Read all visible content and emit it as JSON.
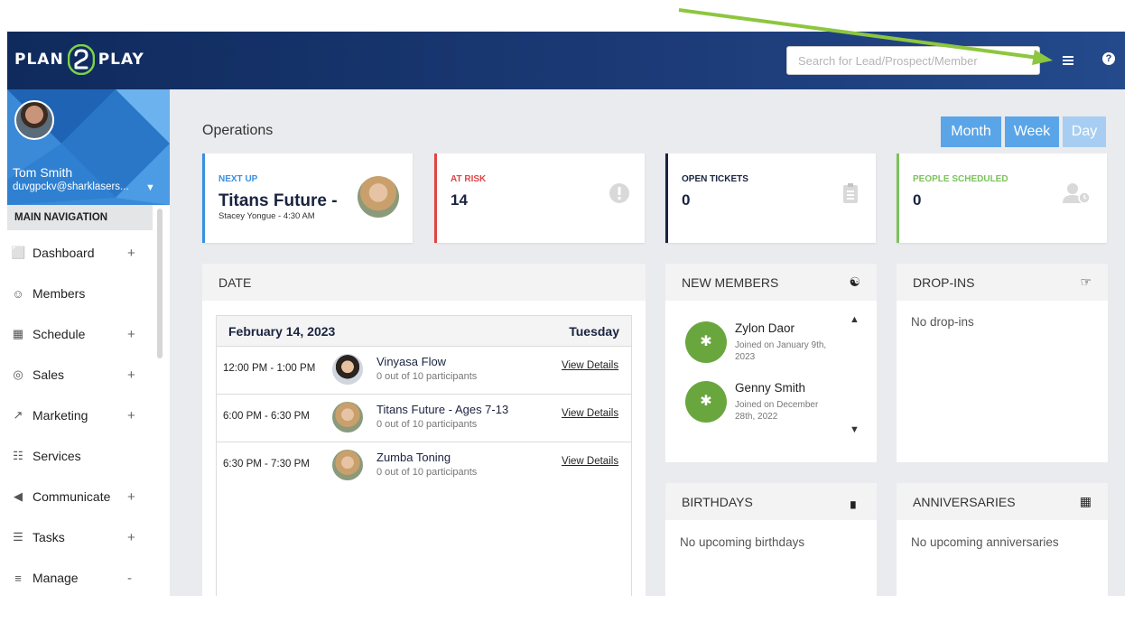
{
  "brand": {
    "left": "PLAN",
    "right": "PLAY"
  },
  "search": {
    "placeholder": "Search for Lead/Prospect/Member"
  },
  "help_glyph": "?",
  "user": {
    "name": "Tom Smith",
    "email": "duvgpckv@sharklasers..."
  },
  "nav": {
    "heading": "MAIN NAVIGATION",
    "items": [
      {
        "label": "Dashboard",
        "icon": "chart-icon",
        "glyph": "⬜",
        "toggle": "+"
      },
      {
        "label": "Members",
        "icon": "users-icon",
        "glyph": "☺",
        "toggle": ""
      },
      {
        "label": "Schedule",
        "icon": "calendar-icon",
        "glyph": "▦",
        "toggle": "+"
      },
      {
        "label": "Sales",
        "icon": "target-icon",
        "glyph": "◎",
        "toggle": "+"
      },
      {
        "label": "Marketing",
        "icon": "line-chart-icon",
        "glyph": "↗",
        "toggle": "+"
      },
      {
        "label": "Services",
        "icon": "grid-icon",
        "glyph": "☷",
        "toggle": ""
      },
      {
        "label": "Communicate",
        "icon": "megaphone-icon",
        "glyph": "◀",
        "toggle": "+"
      },
      {
        "label": "Tasks",
        "icon": "list-icon",
        "glyph": "☰",
        "toggle": "+"
      },
      {
        "label": "Manage",
        "icon": "bars-icon",
        "glyph": "≡",
        "toggle": "-"
      }
    ]
  },
  "main": {
    "title": "Operations",
    "views": [
      "Month",
      "Week",
      "Day"
    ],
    "active_view": "Day",
    "cards": {
      "next_up": {
        "label": "NEXT UP",
        "value": "Titans Future -",
        "sub": "Stacey Yongue - 4:30 AM",
        "color": "#3a8fe0"
      },
      "at_risk": {
        "label": "AT RISK",
        "value": "14",
        "color": "#e04545"
      },
      "open_tickets": {
        "label": "OPEN TICKETS",
        "value": "0",
        "color": "#1a2340"
      },
      "people_scheduled": {
        "label": "PEOPLE SCHEDULED",
        "value": "0",
        "color": "#7cc35b"
      }
    },
    "date_panel": {
      "heading": "DATE",
      "date": "February 14, 2023",
      "weekday": "Tuesday",
      "classes": [
        {
          "time": "12:00 PM - 1:00 PM",
          "name": "Vinyasa Flow",
          "participants": "0 out of 10 participants",
          "link": "View Details"
        },
        {
          "time": "6:00 PM - 6:30 PM",
          "name": "Titans Future - Ages 7-13",
          "participants": "0 out of 10 participants",
          "link": "View Details"
        },
        {
          "time": "6:30 PM - 7:30 PM",
          "name": "Zumba Toning",
          "participants": "0 out of 10 participants",
          "link": "View Details"
        }
      ]
    },
    "new_members": {
      "heading": "NEW MEMBERS",
      "members": [
        {
          "name": "Zylon Daor",
          "joined": "Joined on January 9th, 2023"
        },
        {
          "name": "Genny Smith",
          "joined": "Joined on December 28th, 2022"
        }
      ]
    },
    "drop_ins": {
      "heading": "DROP-INS",
      "empty": "No drop-ins"
    },
    "birthdays": {
      "heading": "BIRTHDAYS",
      "empty": "No upcoming birthdays"
    },
    "anniversaries": {
      "heading": "ANNIVERSARIES",
      "empty": "No upcoming anniversaries"
    }
  }
}
